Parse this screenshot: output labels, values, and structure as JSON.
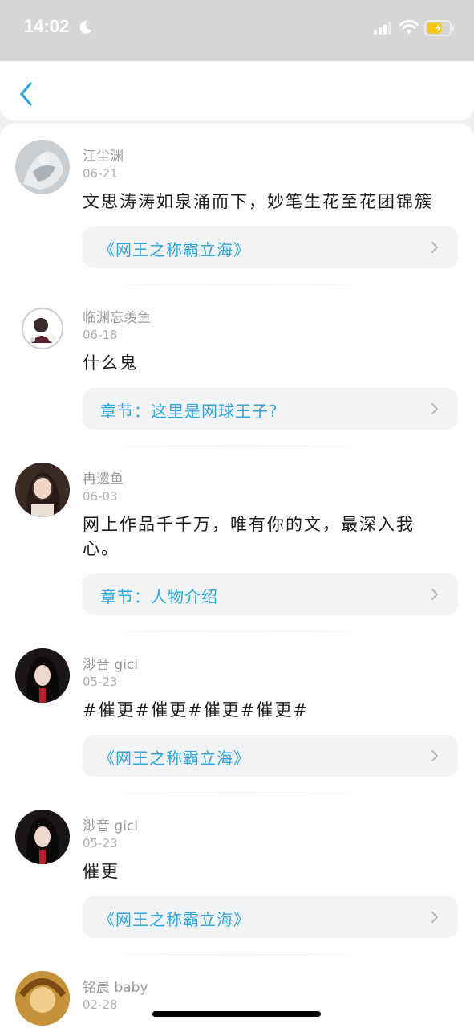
{
  "status_bar": {
    "time": "14:02"
  },
  "comments": [
    {
      "username": "江尘渊",
      "date": "06-21",
      "text": "文思涛涛如泉涌而下，妙笔生花至花团锦簇",
      "link": "《网王之称霸立海》",
      "avatar": "grey-white-figure"
    },
    {
      "username": "临渊忘羡鱼",
      "date": "06-18",
      "text": "什么鬼",
      "link": "章节：这里是网球王子?",
      "avatar": "chibi-character-circle"
    },
    {
      "username": "冉遗鱼",
      "date": "06-03",
      "text": "网上作品千千万，唯有你的文，最深入我心。",
      "link": "章节：人物介绍",
      "avatar": "anime-girl-dark-hair"
    },
    {
      "username": "渺音 gicl",
      "date": "05-23",
      "text": "#催更#催更#催更#催更#",
      "link": "《网王之称霸立海》",
      "avatar": "anime-girl-red-accent"
    },
    {
      "username": "渺音 gicl",
      "date": "05-23",
      "text": "催更",
      "link": "《网王之称霸立海》",
      "avatar": "anime-girl-red-accent"
    },
    {
      "username": "铭晨 baby",
      "date": "02-28",
      "text": "",
      "link": "",
      "avatar": "golden-portrait"
    }
  ]
}
